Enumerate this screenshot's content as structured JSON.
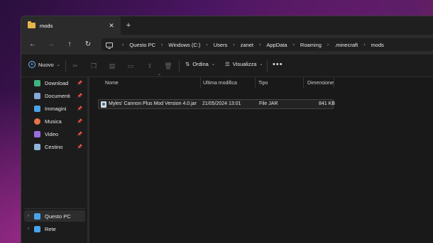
{
  "window": {
    "tab_title": "mods",
    "close_glyph": "✕",
    "new_tab_glyph": "+"
  },
  "nav": {
    "back_glyph": "←",
    "forward_glyph": "→",
    "up_glyph": "↑",
    "refresh_glyph": "↻"
  },
  "breadcrumb": [
    "Questo PC",
    "Windows (C:)",
    "Users",
    "zanet",
    "AppData",
    "Roaming",
    ".minecraft",
    "mods"
  ],
  "toolbar": {
    "new_label": "Nuovo",
    "sort_label": "Ordina",
    "view_label": "Visualizza",
    "more_glyph": "•••",
    "icons": [
      "cut-icon",
      "copy-icon",
      "paste-icon",
      "rename-icon",
      "share-icon",
      "delete-icon"
    ]
  },
  "sidebar": {
    "quick_access": [
      {
        "label": "Download",
        "icon": "download-icon",
        "color": "#3fb27f",
        "pinned": true
      },
      {
        "label": "Documenti",
        "icon": "documents-icon",
        "color": "#8aa7d9",
        "pinned": true
      },
      {
        "label": "Immagini",
        "icon": "pictures-icon",
        "color": "#4aa3e8",
        "pinned": true
      },
      {
        "label": "Musica",
        "icon": "music-icon",
        "color": "#e8734a",
        "pinned": true
      },
      {
        "label": "Video",
        "icon": "video-icon",
        "color": "#9b6ee0",
        "pinned": true
      },
      {
        "label": "Cestino",
        "icon": "recycle-bin-icon",
        "color": "#8fb6d9",
        "pinned": true
      }
    ],
    "locations": [
      {
        "label": "Questo PC",
        "icon": "this-pc-icon",
        "color": "#4aa3e8",
        "selected": true
      },
      {
        "label": "Rete",
        "icon": "network-icon",
        "color": "#4aa3e8",
        "selected": false
      }
    ]
  },
  "columns": {
    "name": "Nome",
    "modified": "Ultima modifica",
    "type": "Tipo",
    "size": "Dimensione"
  },
  "files": [
    {
      "name": "Myles' Cannon Plus Mod Version 4.0.jar",
      "modified": "21/05/2024 13:01",
      "type": "File JAR",
      "size": "841 KB"
    }
  ]
}
